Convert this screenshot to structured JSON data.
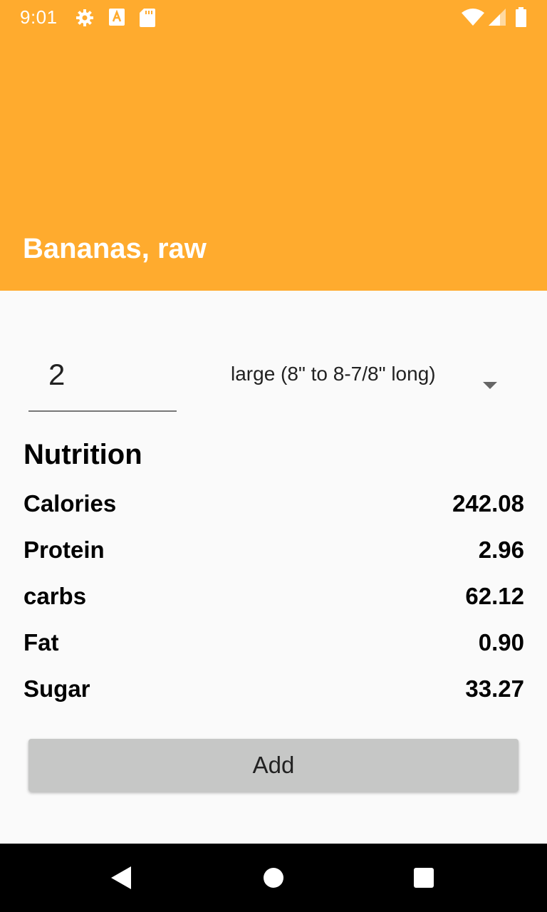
{
  "status_bar": {
    "time": "9:01",
    "icons": [
      "settings-icon",
      "a-badge-icon",
      "sd-card-icon",
      "wifi-icon",
      "signal-icon",
      "battery-icon"
    ]
  },
  "app_bar": {
    "title": "Bananas, raw",
    "color": "#ffab2e"
  },
  "form": {
    "quantity": "2",
    "unit": "large (8\" to 8-7/8\" long)"
  },
  "nutrition": {
    "heading": "Nutrition",
    "rows": [
      {
        "label": "Calories",
        "value": "242.08"
      },
      {
        "label": "Protein",
        "value": "2.96"
      },
      {
        "label": "carbs",
        "value": "62.12"
      },
      {
        "label": "Fat",
        "value": "0.90"
      },
      {
        "label": "Sugar",
        "value": "33.27"
      }
    ]
  },
  "actions": {
    "add_label": "Add"
  },
  "nav_bar": {
    "icons": [
      "back-icon",
      "home-icon",
      "recents-icon"
    ]
  }
}
